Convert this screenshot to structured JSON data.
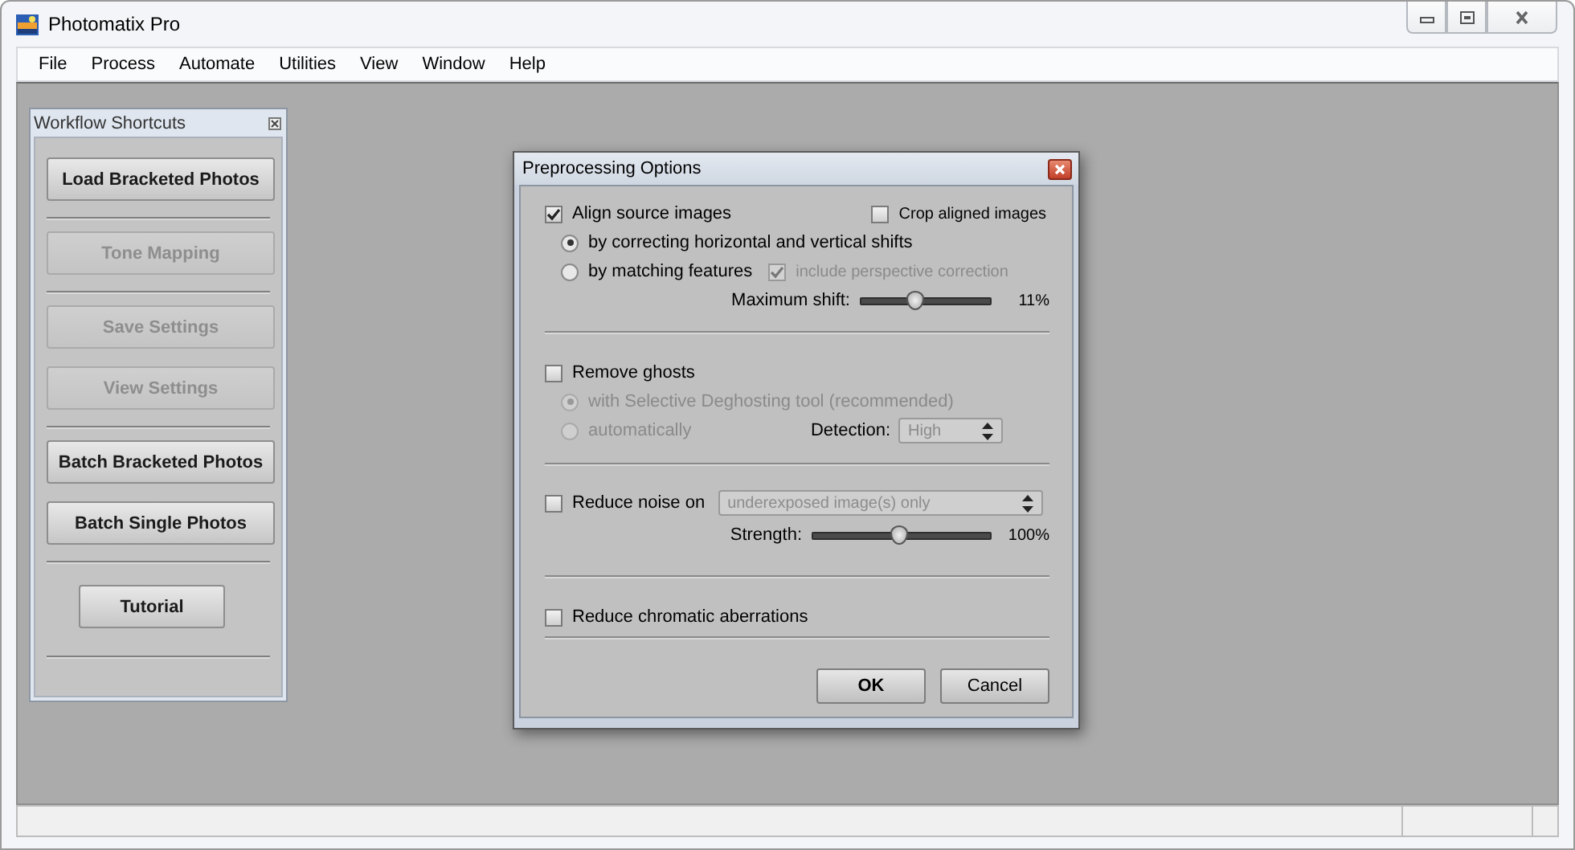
{
  "window": {
    "title": "Photomatix Pro"
  },
  "menu": [
    "File",
    "Process",
    "Automate",
    "Utilities",
    "View",
    "Window",
    "Help"
  ],
  "shortcuts_panel": {
    "title": "Workflow Shortcuts",
    "groups": [
      {
        "buttons": [
          {
            "label": "Load Bracketed Photos",
            "disabled": false,
            "kind": "wide"
          }
        ]
      },
      {
        "buttons": [
          {
            "label": "Tone Mapping",
            "disabled": true,
            "kind": "wide"
          }
        ]
      },
      {
        "buttons": [
          {
            "label": "Save Settings",
            "disabled": true,
            "kind": "wide"
          },
          {
            "label": "View Settings",
            "disabled": true,
            "kind": "wide"
          }
        ]
      },
      {
        "buttons": [
          {
            "label": "Batch Bracketed Photos",
            "disabled": false,
            "kind": "wide"
          },
          {
            "label": "Batch Single Photos",
            "disabled": false,
            "kind": "wide"
          }
        ]
      },
      {
        "buttons": [
          {
            "label": "Tutorial",
            "disabled": false,
            "kind": "narrow"
          }
        ]
      }
    ]
  },
  "dialog": {
    "title": "Preprocessing Options",
    "align": {
      "label": "Align source images",
      "checked": true
    },
    "crop": {
      "label": "Crop aligned images",
      "checked": false
    },
    "align_methods": [
      {
        "label": "by correcting horizontal and vertical shifts",
        "selected": true
      },
      {
        "label": "by matching features",
        "selected": false
      }
    ],
    "perspective": {
      "label": "include perspective correction",
      "checked": true,
      "disabled": true
    },
    "max_shift": {
      "label": "Maximum shift:",
      "level": 0.42,
      "reading": "11%"
    },
    "remove_ghosts": {
      "label": "Remove ghosts",
      "checked": false
    },
    "ghost_methods": [
      {
        "label": "with Selective Deghosting tool (recommended)",
        "selected": true,
        "disabled": true
      },
      {
        "label": "automatically",
        "selected": false,
        "disabled": true
      }
    ],
    "detection": {
      "label": "Detection:",
      "value": "High",
      "disabled": true
    },
    "reduce_noise": {
      "label": "Reduce noise on",
      "checked": false
    },
    "noise_target": {
      "value": "underexposed image(s) only",
      "disabled": true
    },
    "strength": {
      "label": "Strength:",
      "level": 0.49,
      "reading": "100%"
    },
    "chromatic": {
      "label": "Reduce chromatic aberrations",
      "checked": false
    },
    "buttons": [
      "OK",
      "Cancel"
    ]
  }
}
